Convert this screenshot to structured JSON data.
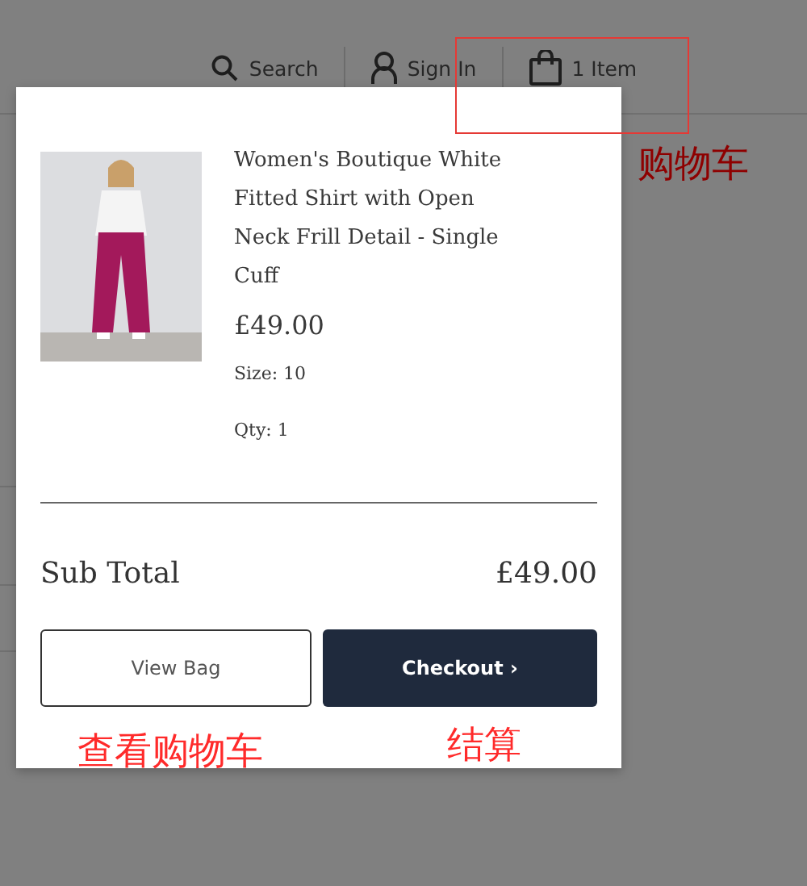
{
  "header": {
    "nav": [
      {
        "kind": "search",
        "label": "Search"
      },
      {
        "kind": "account",
        "label": "Sign In"
      },
      {
        "kind": "bag",
        "label": "1 Item",
        "annotation": "购物车"
      }
    ]
  },
  "mini_bag": {
    "items": [
      {
        "name": "Women's Boutique White Fitted Shirt with Open Neck Frill Detail - Single Cuff",
        "price": "£49.00",
        "size": "Size: 10",
        "qty": "Qty: 1"
      }
    ],
    "subtotal": {
      "label": "Sub Total",
      "value": "£49.00"
    },
    "buttons": [
      {
        "kind": "secondary",
        "label": "View Bag",
        "annotation": "查看购物车"
      },
      {
        "kind": "primary",
        "label": "Checkout ›",
        "annotation": "结算"
      }
    ]
  }
}
